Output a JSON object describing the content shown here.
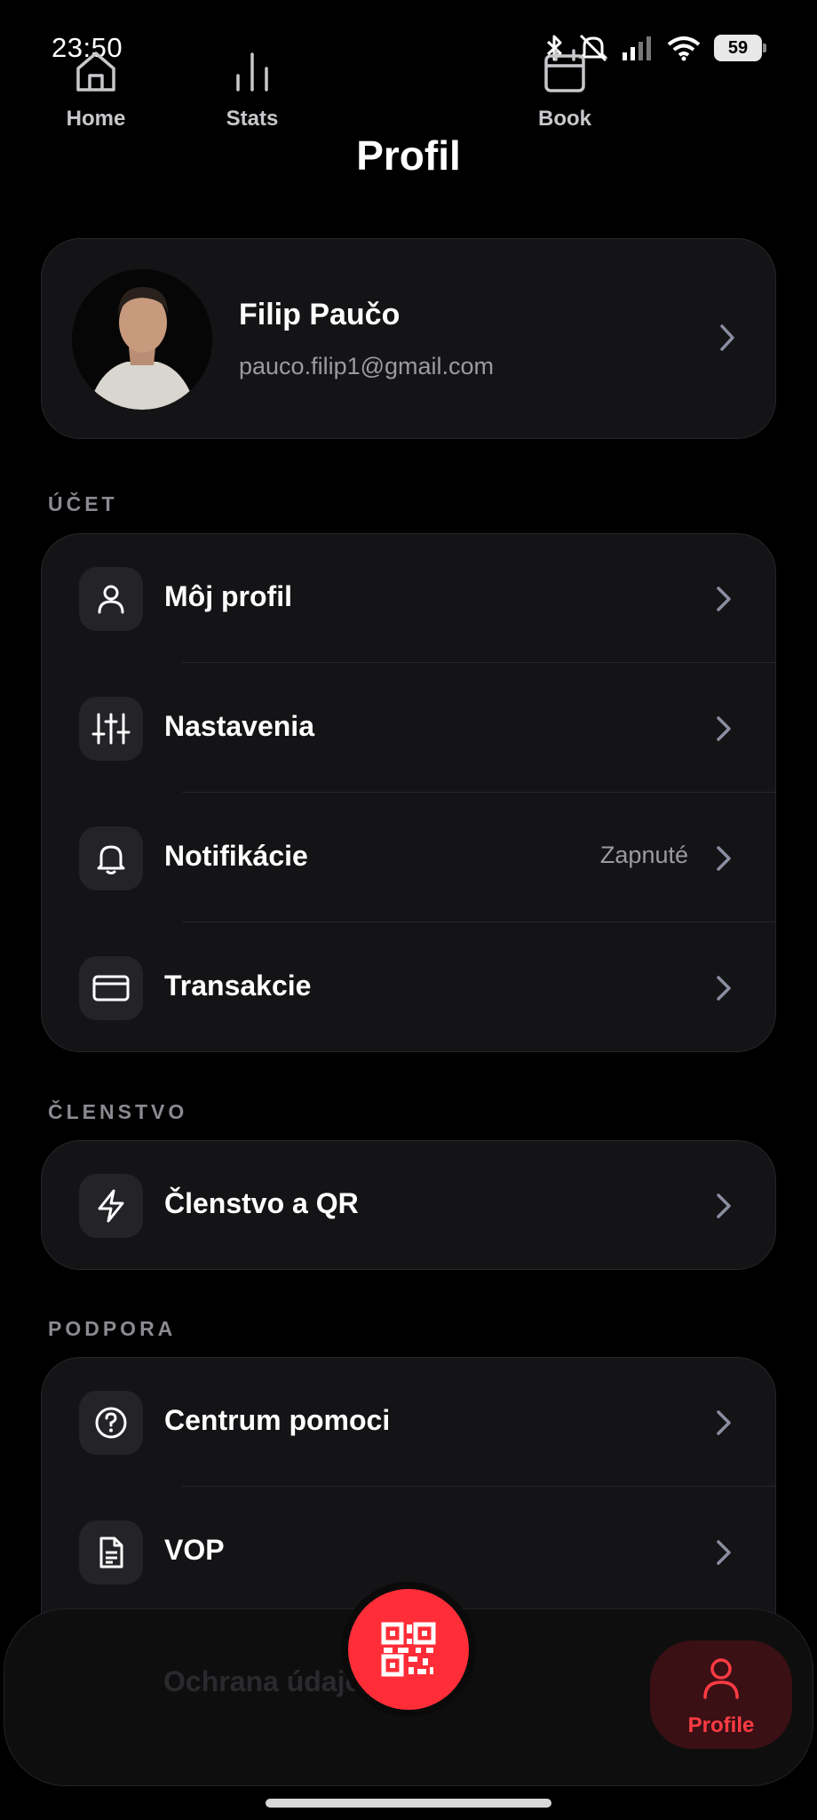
{
  "status_bar": {
    "time": "23:50",
    "battery": "59"
  },
  "header": {
    "title": "Profil"
  },
  "profile": {
    "name": "Filip Paučo",
    "email": "pauco.filip1@gmail.com"
  },
  "sections": {
    "account": {
      "label": "ÚČET",
      "items": [
        {
          "label": "Môj profil",
          "icon": "user-icon"
        },
        {
          "label": "Nastavenia",
          "icon": "sliders-icon"
        },
        {
          "label": "Notifikácie",
          "icon": "bell-icon",
          "value": "Zapnuté"
        },
        {
          "label": "Transakcie",
          "icon": "credit-card-icon"
        }
      ]
    },
    "membership": {
      "label": "ČLENSTVO",
      "items": [
        {
          "label": "Členstvo a QR",
          "icon": "lightning-icon"
        }
      ]
    },
    "support": {
      "label": "PODPORA",
      "items": [
        {
          "label": "Centrum pomoci",
          "icon": "help-circle-icon"
        },
        {
          "label": "VOP",
          "icon": "document-icon"
        },
        {
          "label": "Ochrana údajov",
          "icon": "shield-icon"
        }
      ]
    }
  },
  "bottom_nav": {
    "items": [
      {
        "label": "Home",
        "icon": "home-icon"
      },
      {
        "label": "Stats",
        "icon": "bar-chart-icon"
      },
      {
        "label": "Book",
        "icon": "calendar-icon"
      },
      {
        "label": "Profile",
        "icon": "user-icon",
        "active": true
      }
    ],
    "fab_icon": "qr-code-icon"
  },
  "colors": {
    "accent": "#ff2d38",
    "background": "#000000",
    "card": "#141416",
    "muted": "#9a9aa2"
  }
}
